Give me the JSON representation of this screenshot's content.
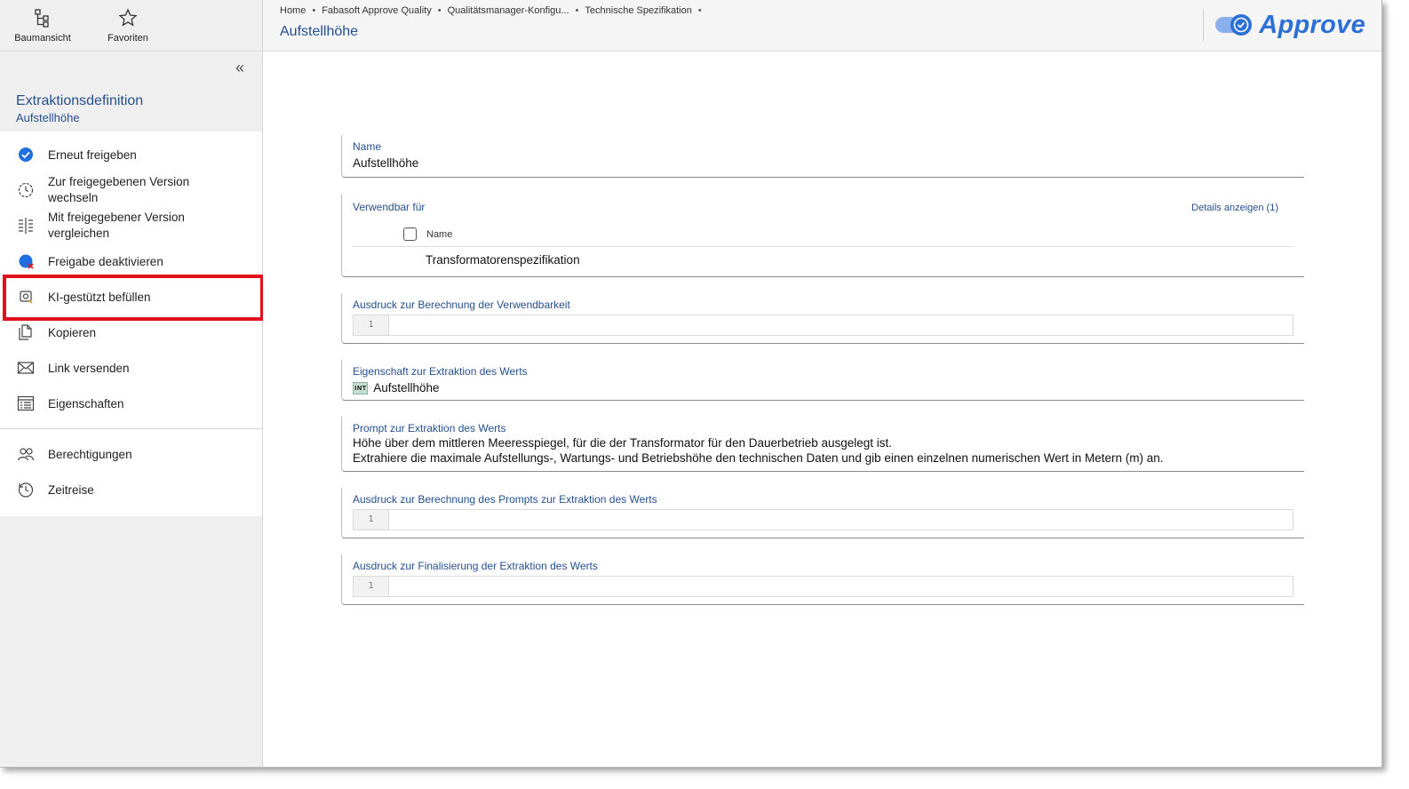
{
  "toolbar": {
    "tree_view": "Baumansicht",
    "favorites": "Favoriten"
  },
  "sidebar": {
    "collapse_glyph": "«",
    "object_type": "Extraktionsdefinition",
    "object_name": "Aufstellhöhe",
    "actions": [
      {
        "label": "Erneut freigeben",
        "icon": "check-circle-icon"
      },
      {
        "label": "Zur freigegebenen Version wechseln",
        "icon": "switch-version-icon"
      },
      {
        "label": "Mit freigegebener Version vergleichen",
        "icon": "compare-icon"
      },
      {
        "label": "Freigabe deaktivieren",
        "icon": "deactivate-release-icon"
      },
      {
        "label": "KI-gestützt befüllen",
        "icon": "ai-fill-icon"
      },
      {
        "label": "Kopieren",
        "icon": "copy-icon"
      },
      {
        "label": "Link versenden",
        "icon": "mail-icon"
      },
      {
        "label": "Eigenschaften",
        "icon": "properties-icon"
      }
    ],
    "actions2": [
      {
        "label": "Berechtigungen",
        "icon": "users-icon"
      },
      {
        "label": "Zeitreise",
        "icon": "history-icon"
      }
    ]
  },
  "header": {
    "breadcrumb": [
      "Home",
      "Fabasoft Approve Quality",
      "Qualitätsmanager-Konfigu...",
      "Technische Spezifikation"
    ],
    "separator": "•",
    "page_title": "Aufstellhöhe",
    "logo_text": "Approve"
  },
  "form": {
    "name": {
      "label": "Name",
      "value": "Aufstellhöhe"
    },
    "usable_for": {
      "label": "Verwendbar für",
      "details_link": "Details anzeigen (1)",
      "column_name": "Name",
      "rows": [
        "Transformatorenspezifikation"
      ]
    },
    "usability_expression": {
      "label": "Ausdruck zur Berechnung der Verwendbarkeit",
      "line_number": "1"
    },
    "extraction_property": {
      "label": "Eigenschaft zur Extraktion des Werts",
      "badge": "INT",
      "value": "Aufstellhöhe"
    },
    "prompt": {
      "label": "Prompt zur Extraktion des Werts",
      "line1": "Höhe über dem mittleren Meeresspiegel, für die der Transformator für den Dauerbetrieb ausgelegt ist.",
      "line2": "Extrahiere die maximale Aufstellungs-, Wartungs- und Betriebshöhe den technischen Daten und gib einen einzelnen numerischen Wert in Metern (m) an."
    },
    "prompt_expression": {
      "label": "Ausdruck zur Berechnung des Prompts zur Extraktion des Werts",
      "line_number": "1"
    },
    "finalize_expression": {
      "label": "Ausdruck zur Finalisierung der Extraktion des Werts",
      "line_number": "1"
    }
  },
  "colors": {
    "accent": "#25508f",
    "brand": "#2c6fd6",
    "highlight": "#e3101c",
    "check": "#1f6fe0"
  }
}
